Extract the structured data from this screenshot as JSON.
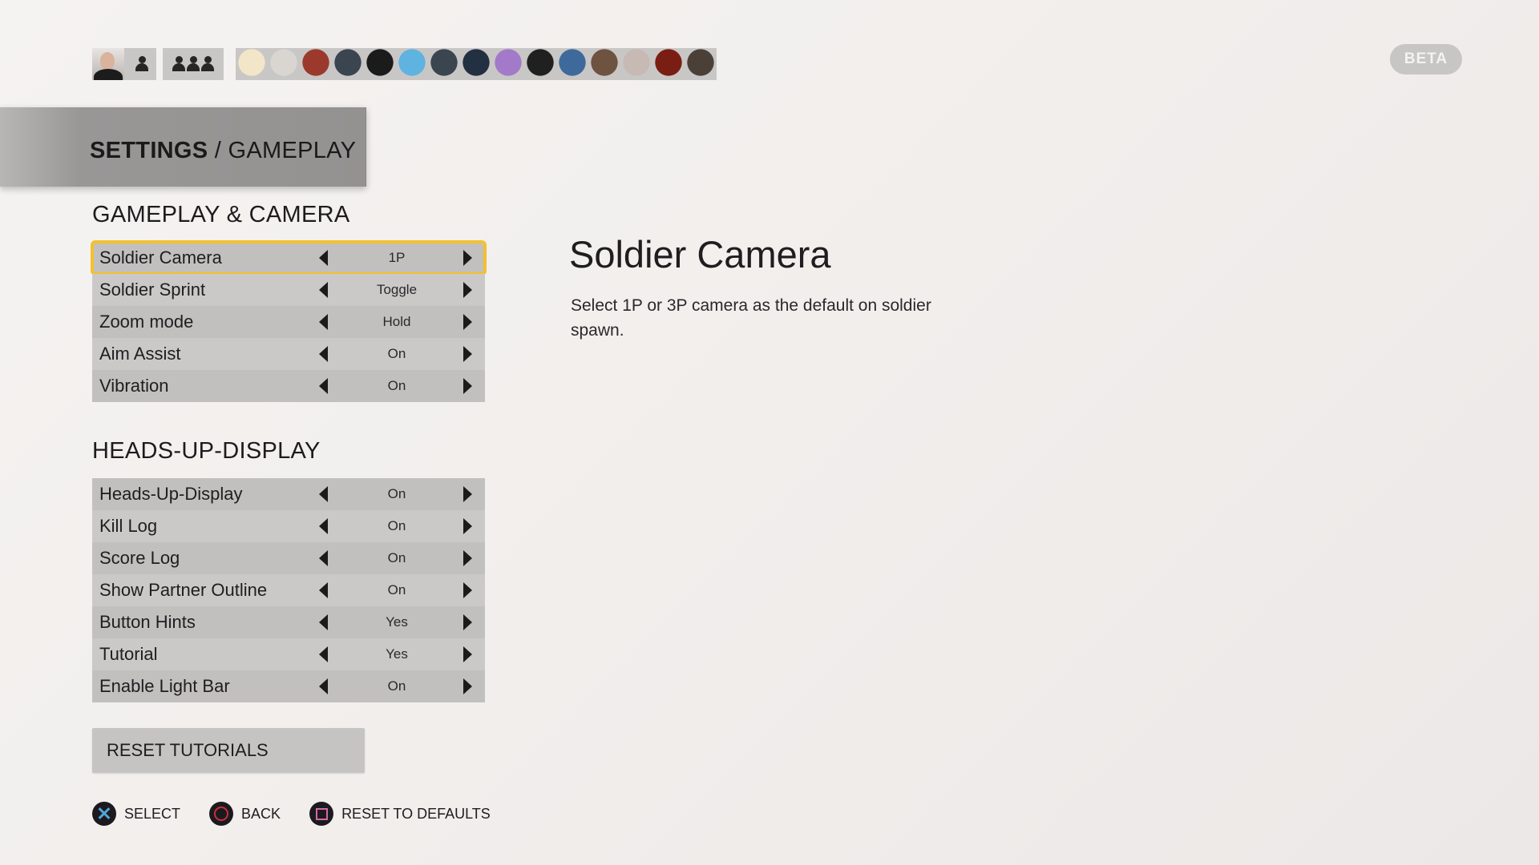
{
  "top_bar": {
    "self_user": {
      "avatar": "user-photo",
      "icon": "person-icon"
    },
    "party_icon": "party-icon",
    "friend_avatars": [
      "tiger-avatar",
      "hooded-assassin-avatar",
      "red-hat-avatar",
      "killzone-soldier-pro-avatar",
      "penguin-avatar",
      "cartoon-kid-avatar",
      "killzone-soldier-pro-avatar-2",
      "dark-haired-woman-avatar",
      "purple-creature-avatar",
      "helghast-helmet-avatar",
      "raccoon-thief-avatar",
      "adventurer-avatar",
      "robot-mask-avatar",
      "red-haired-character-avatar",
      "man-portrait-avatar"
    ],
    "friend_colors": [
      "#f3e6c8",
      "#d9d6d2",
      "#9b3a2c",
      "#3b4550",
      "#1b1b1b",
      "#5fb3e0",
      "#3b4550",
      "#233042",
      "#a37ac9",
      "#202020",
      "#3d6a9a",
      "#6e5341",
      "#c7b9b3",
      "#7a1d13",
      "#4a4038"
    ],
    "beta_label": "BETA"
  },
  "breadcrumb": {
    "root": "SETTINGS",
    "separator": " / ",
    "current": "GAMEPLAY"
  },
  "sections": [
    {
      "title": "GAMEPLAY & CAMERA",
      "rows": [
        {
          "label": "Soldier Camera",
          "value": "1P",
          "selected": true
        },
        {
          "label": "Soldier Sprint",
          "value": "Toggle"
        },
        {
          "label": "Zoom mode",
          "value": "Hold"
        },
        {
          "label": "Aim Assist",
          "value": "On"
        },
        {
          "label": "Vibration",
          "value": "On"
        }
      ]
    },
    {
      "title": "HEADS-UP-DISPLAY",
      "rows": [
        {
          "label": "Heads-Up-Display",
          "value": "On"
        },
        {
          "label": "Kill Log",
          "value": "On"
        },
        {
          "label": "Score Log",
          "value": "On"
        },
        {
          "label": "Show Partner Outline",
          "value": "On"
        },
        {
          "label": "Button Hints",
          "value": "Yes"
        },
        {
          "label": "Tutorial",
          "value": "Yes"
        },
        {
          "label": "Enable Light Bar",
          "value": "On"
        }
      ]
    }
  ],
  "reset_tutorials_label": "RESET TUTORIALS",
  "detail": {
    "title": "Soldier Camera",
    "description": "Select 1P or 3P camera as the default on soldier spawn."
  },
  "button_hints": [
    {
      "icon": "cross-icon",
      "label": "SELECT"
    },
    {
      "icon": "circle-icon",
      "label": "BACK"
    },
    {
      "icon": "square-icon",
      "label": "RESET TO DEFAULTS"
    }
  ],
  "colors": {
    "selection_outline": "#f2c12e",
    "cross": "#4fa6d8",
    "circle": "#c6303e",
    "square": "#d46aa3"
  }
}
